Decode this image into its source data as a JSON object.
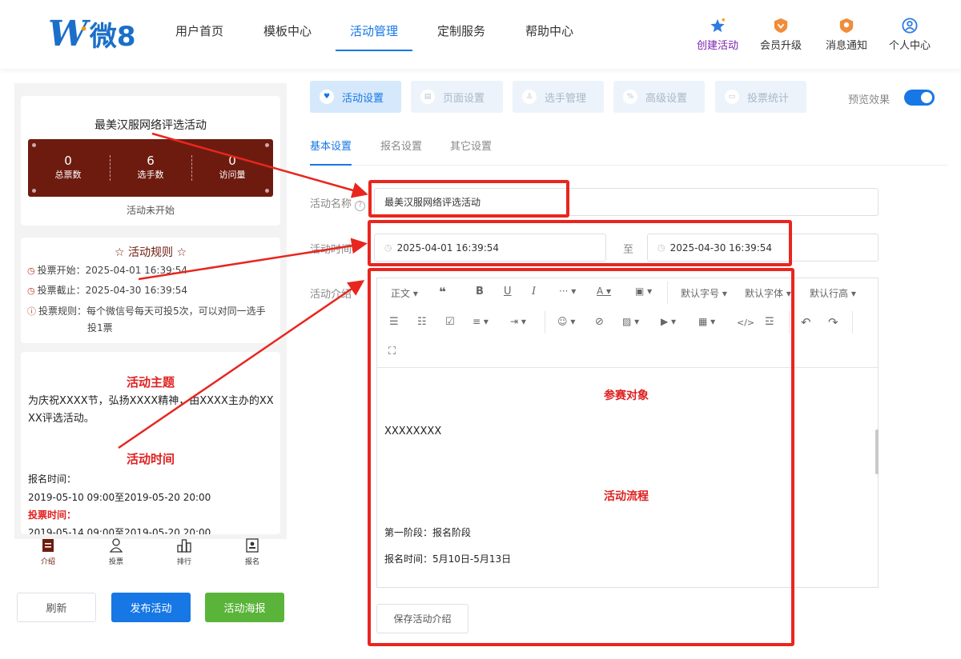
{
  "header": {
    "logo_text": "微8",
    "nav": [
      "用户首页",
      "模板中心",
      "活动管理",
      "定制服务",
      "帮助中心"
    ],
    "actions": [
      {
        "label": "创建活动",
        "icon": "star-icon"
      },
      {
        "label": "会员升级",
        "icon": "vip-badge-icon"
      },
      {
        "label": "消息通知",
        "icon": "bell-badge-icon"
      },
      {
        "label": "个人中心",
        "icon": "user-icon"
      }
    ]
  },
  "preview": {
    "title": "最美汉服网络评选活动",
    "stats": [
      {
        "value": "0",
        "label": "总票数"
      },
      {
        "value": "6",
        "label": "选手数"
      },
      {
        "value": "0",
        "label": "访问量"
      }
    ],
    "status": "活动未开始",
    "rules_title": "活动规则",
    "rules": [
      "投票开始：2025-04-01 16:39:54",
      "投票截止：2025-04-30 16:39:54",
      "投票规则：每个微信号每天可投5次，可以对同一选手",
      "投1票"
    ],
    "theme_heading": "活动主题",
    "theme_text_1": "为庆祝XXXX节，弘扬XXXX精神，由XXXX主办的XX",
    "theme_text_2": "XX评选活动。",
    "time_heading": "活动时间",
    "signup_label": "报名时间：",
    "signup_range": "2019-05-10 09:00至2019-05-20 20:00",
    "vote_label": "投票时间：",
    "vote_range": "2019-05-14 09:00至2019-05-20 20:00",
    "bottom_nav": [
      "介绍",
      "投票",
      "排行",
      "报名"
    ],
    "buttons": {
      "refresh": "刷新",
      "publish": "发布活动",
      "poster": "活动海报"
    }
  },
  "main_tabs": [
    "活动设置",
    "页面设置",
    "选手管理",
    "高级设置",
    "投票统计"
  ],
  "preview_toggle_label": "预览效果",
  "preview_toggle_on": true,
  "sub_tabs": [
    "基本设置",
    "报名设置",
    "其它设置"
  ],
  "form": {
    "name_label": "活动名称",
    "name_value": "最美汉服网络评选活动",
    "time_label": "活动时间",
    "start": "2025-04-01 16:39:54",
    "to": "至",
    "end": "2025-04-30 16:39:54",
    "intro_label": "活动介绍"
  },
  "toolbar": {
    "paragraph": "正文",
    "font_size": "默认字号",
    "font_family": "默认字体",
    "line_height": "默认行高"
  },
  "editor": {
    "heading1": "参赛对象",
    "text1": "XXXXXXXX",
    "heading2": "活动流程",
    "text2": "第一阶段：报名阶段",
    "text3": "报名时间：5月10日-5月13日"
  },
  "save_label": "保存活动介绍",
  "colors": {
    "accent": "#1677e5",
    "annotation": "#e8261f",
    "card": "#6e1b0f",
    "heading_red": "#e02020",
    "publish": "#1677e5",
    "poster": "#5ab43a"
  }
}
